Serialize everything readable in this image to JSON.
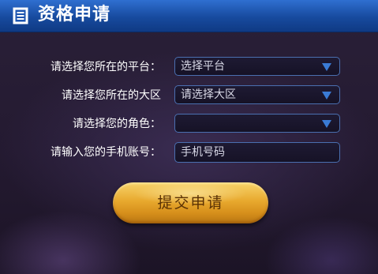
{
  "header": {
    "title": "资格申请",
    "icon": "document-icon",
    "color": "#174a9e"
  },
  "form": {
    "platform": {
      "label": "请选择您所在的平台：",
      "value": "选择平台"
    },
    "region": {
      "label": "请选择您所在的大区",
      "value": "请选择大区"
    },
    "role": {
      "label": "请选择您的角色：",
      "value": ""
    },
    "phone": {
      "label": "请输入您的手机账号：",
      "placeholder": "手机号码"
    },
    "submit_label": "提交申请"
  },
  "colors": {
    "accent_gold": "#e8a92e",
    "field_border": "#4a6fb0",
    "arrow": "#3a7bd5"
  }
}
